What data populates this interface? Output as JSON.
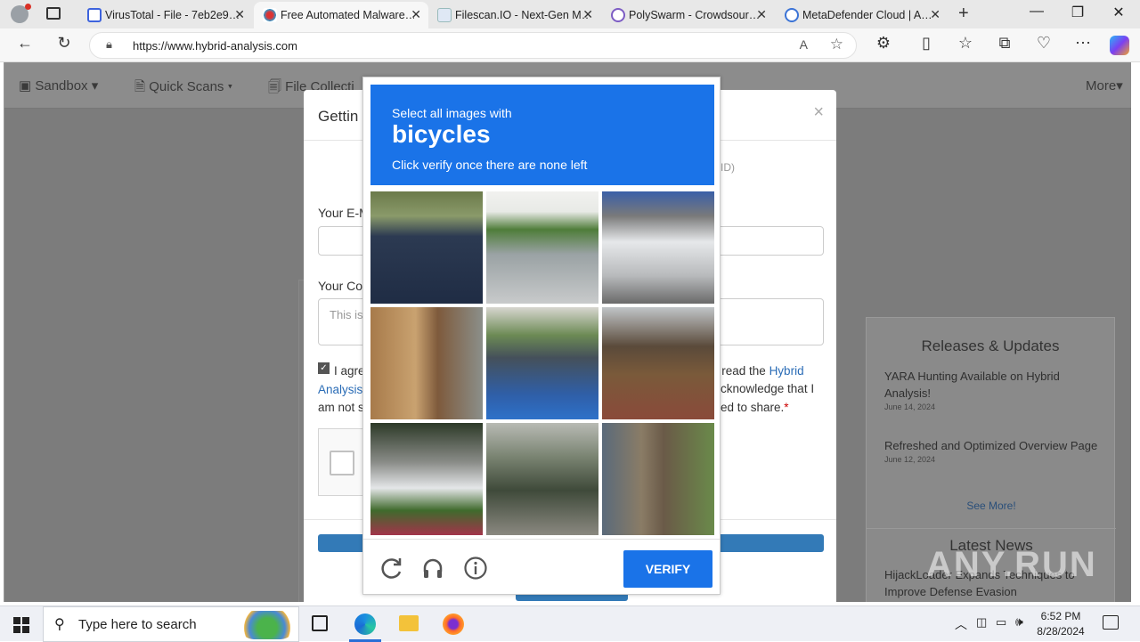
{
  "browser": {
    "tabs": [
      {
        "label": "VirusTotal - File - 7eb2e9…",
        "icon": "virustotal-icon"
      },
      {
        "label": "Free Automated Malware…",
        "icon": "hybrid-analysis-icon",
        "active": true
      },
      {
        "label": "Filescan.IO - Next-Gen M…",
        "icon": "filescan-icon"
      },
      {
        "label": "PolySwarm - Crowdsour…",
        "icon": "polyswarm-icon"
      },
      {
        "label": "MetaDefender Cloud | A…",
        "icon": "loading-icon"
      }
    ],
    "url": "https://www.hybrid-analysis.com"
  },
  "nav": {
    "sandbox": "Sandbox",
    "quick_scans": "Quick Scans",
    "file_collections": "File Collecti",
    "more": "More"
  },
  "modal": {
    "title": "Gettin",
    "id_hint": "ID)",
    "email_label": "Your E-M",
    "comment_label": "Your Co",
    "comment_placeholder": "This is",
    "agree_text_a": "I agre",
    "agree_link_a": "Hybrid",
    "agree_link_b": "Analysis",
    "agree_mid1": "e read the",
    "agree_mid2": "cknowledge that I",
    "agree_line3a": "am not s",
    "agree_line3b": "ed to share.",
    "required_star": "*"
  },
  "sidebar": {
    "releases_title": "Releases & Updates",
    "items": [
      {
        "title": "YARA Hunting Available on Hybrid Analysis!",
        "date": "June 14, 2024"
      },
      {
        "title": "Refreshed and Optimized Overview Page",
        "date": "June 12, 2024"
      }
    ],
    "see_more": "See More!",
    "latest_news_title": "Latest News",
    "news_item": "HijackLoader Expands Techniques to Improve Defense Evasion"
  },
  "captcha": {
    "line1": "Select all images with",
    "target": "bicycles",
    "line3": "Click verify once there are none left",
    "verify": "VERIFY",
    "accent": "#1a73e8",
    "tiles": [
      "shadow-on-pavement",
      "parking-lot-blue-car",
      "white-truck",
      "statue-porch-flowers",
      "road-blue-car-hood",
      "garage-covered-patio",
      "street-trees-cars",
      "foggy-highway-trees",
      "tree-trunk-fence"
    ]
  },
  "taskbar": {
    "search_placeholder": "Type here to search",
    "time": "6:52 PM",
    "date": "8/28/2024"
  },
  "watermark": "ANY.RUN"
}
